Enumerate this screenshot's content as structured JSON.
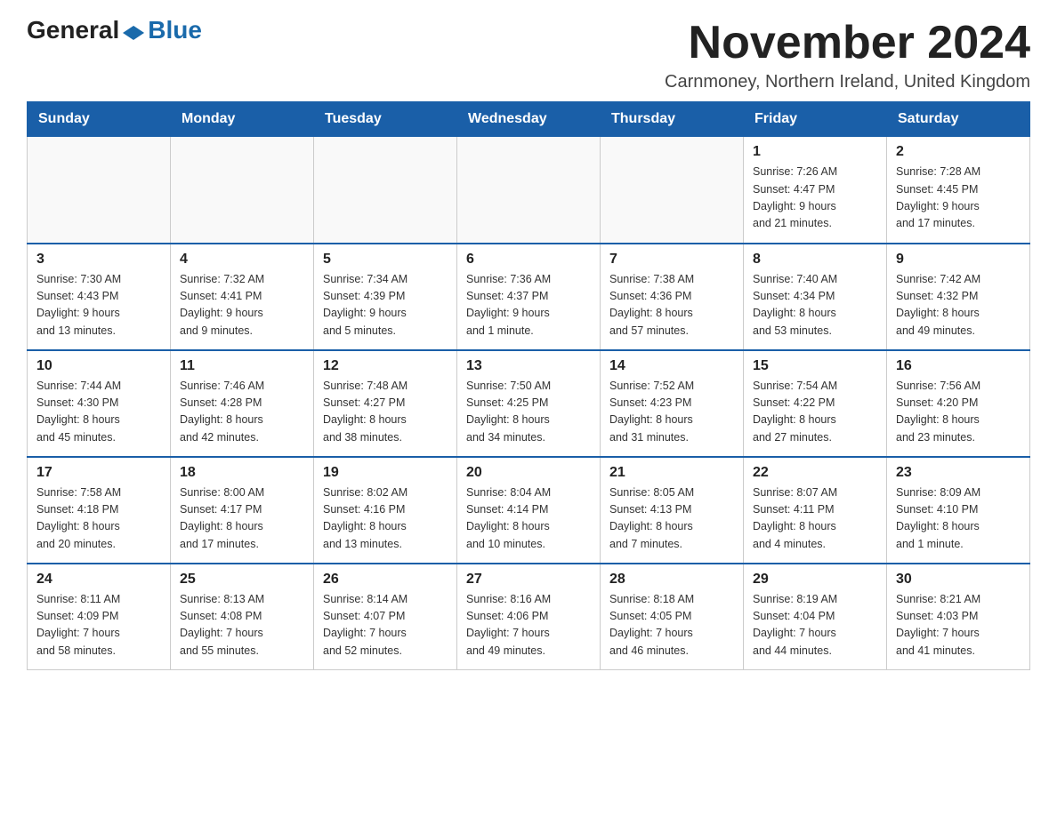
{
  "header": {
    "logo_general": "General",
    "logo_blue": "Blue",
    "month_title": "November 2024",
    "location": "Carnmoney, Northern Ireland, United Kingdom"
  },
  "weekdays": [
    "Sunday",
    "Monday",
    "Tuesday",
    "Wednesday",
    "Thursday",
    "Friday",
    "Saturday"
  ],
  "weeks": [
    [
      {
        "day": "",
        "info": ""
      },
      {
        "day": "",
        "info": ""
      },
      {
        "day": "",
        "info": ""
      },
      {
        "day": "",
        "info": ""
      },
      {
        "day": "",
        "info": ""
      },
      {
        "day": "1",
        "info": "Sunrise: 7:26 AM\nSunset: 4:47 PM\nDaylight: 9 hours\nand 21 minutes."
      },
      {
        "day": "2",
        "info": "Sunrise: 7:28 AM\nSunset: 4:45 PM\nDaylight: 9 hours\nand 17 minutes."
      }
    ],
    [
      {
        "day": "3",
        "info": "Sunrise: 7:30 AM\nSunset: 4:43 PM\nDaylight: 9 hours\nand 13 minutes."
      },
      {
        "day": "4",
        "info": "Sunrise: 7:32 AM\nSunset: 4:41 PM\nDaylight: 9 hours\nand 9 minutes."
      },
      {
        "day": "5",
        "info": "Sunrise: 7:34 AM\nSunset: 4:39 PM\nDaylight: 9 hours\nand 5 minutes."
      },
      {
        "day": "6",
        "info": "Sunrise: 7:36 AM\nSunset: 4:37 PM\nDaylight: 9 hours\nand 1 minute."
      },
      {
        "day": "7",
        "info": "Sunrise: 7:38 AM\nSunset: 4:36 PM\nDaylight: 8 hours\nand 57 minutes."
      },
      {
        "day": "8",
        "info": "Sunrise: 7:40 AM\nSunset: 4:34 PM\nDaylight: 8 hours\nand 53 minutes."
      },
      {
        "day": "9",
        "info": "Sunrise: 7:42 AM\nSunset: 4:32 PM\nDaylight: 8 hours\nand 49 minutes."
      }
    ],
    [
      {
        "day": "10",
        "info": "Sunrise: 7:44 AM\nSunset: 4:30 PM\nDaylight: 8 hours\nand 45 minutes."
      },
      {
        "day": "11",
        "info": "Sunrise: 7:46 AM\nSunset: 4:28 PM\nDaylight: 8 hours\nand 42 minutes."
      },
      {
        "day": "12",
        "info": "Sunrise: 7:48 AM\nSunset: 4:27 PM\nDaylight: 8 hours\nand 38 minutes."
      },
      {
        "day": "13",
        "info": "Sunrise: 7:50 AM\nSunset: 4:25 PM\nDaylight: 8 hours\nand 34 minutes."
      },
      {
        "day": "14",
        "info": "Sunrise: 7:52 AM\nSunset: 4:23 PM\nDaylight: 8 hours\nand 31 minutes."
      },
      {
        "day": "15",
        "info": "Sunrise: 7:54 AM\nSunset: 4:22 PM\nDaylight: 8 hours\nand 27 minutes."
      },
      {
        "day": "16",
        "info": "Sunrise: 7:56 AM\nSunset: 4:20 PM\nDaylight: 8 hours\nand 23 minutes."
      }
    ],
    [
      {
        "day": "17",
        "info": "Sunrise: 7:58 AM\nSunset: 4:18 PM\nDaylight: 8 hours\nand 20 minutes."
      },
      {
        "day": "18",
        "info": "Sunrise: 8:00 AM\nSunset: 4:17 PM\nDaylight: 8 hours\nand 17 minutes."
      },
      {
        "day": "19",
        "info": "Sunrise: 8:02 AM\nSunset: 4:16 PM\nDaylight: 8 hours\nand 13 minutes."
      },
      {
        "day": "20",
        "info": "Sunrise: 8:04 AM\nSunset: 4:14 PM\nDaylight: 8 hours\nand 10 minutes."
      },
      {
        "day": "21",
        "info": "Sunrise: 8:05 AM\nSunset: 4:13 PM\nDaylight: 8 hours\nand 7 minutes."
      },
      {
        "day": "22",
        "info": "Sunrise: 8:07 AM\nSunset: 4:11 PM\nDaylight: 8 hours\nand 4 minutes."
      },
      {
        "day": "23",
        "info": "Sunrise: 8:09 AM\nSunset: 4:10 PM\nDaylight: 8 hours\nand 1 minute."
      }
    ],
    [
      {
        "day": "24",
        "info": "Sunrise: 8:11 AM\nSunset: 4:09 PM\nDaylight: 7 hours\nand 58 minutes."
      },
      {
        "day": "25",
        "info": "Sunrise: 8:13 AM\nSunset: 4:08 PM\nDaylight: 7 hours\nand 55 minutes."
      },
      {
        "day": "26",
        "info": "Sunrise: 8:14 AM\nSunset: 4:07 PM\nDaylight: 7 hours\nand 52 minutes."
      },
      {
        "day": "27",
        "info": "Sunrise: 8:16 AM\nSunset: 4:06 PM\nDaylight: 7 hours\nand 49 minutes."
      },
      {
        "day": "28",
        "info": "Sunrise: 8:18 AM\nSunset: 4:05 PM\nDaylight: 7 hours\nand 46 minutes."
      },
      {
        "day": "29",
        "info": "Sunrise: 8:19 AM\nSunset: 4:04 PM\nDaylight: 7 hours\nand 44 minutes."
      },
      {
        "day": "30",
        "info": "Sunrise: 8:21 AM\nSunset: 4:03 PM\nDaylight: 7 hours\nand 41 minutes."
      }
    ]
  ]
}
